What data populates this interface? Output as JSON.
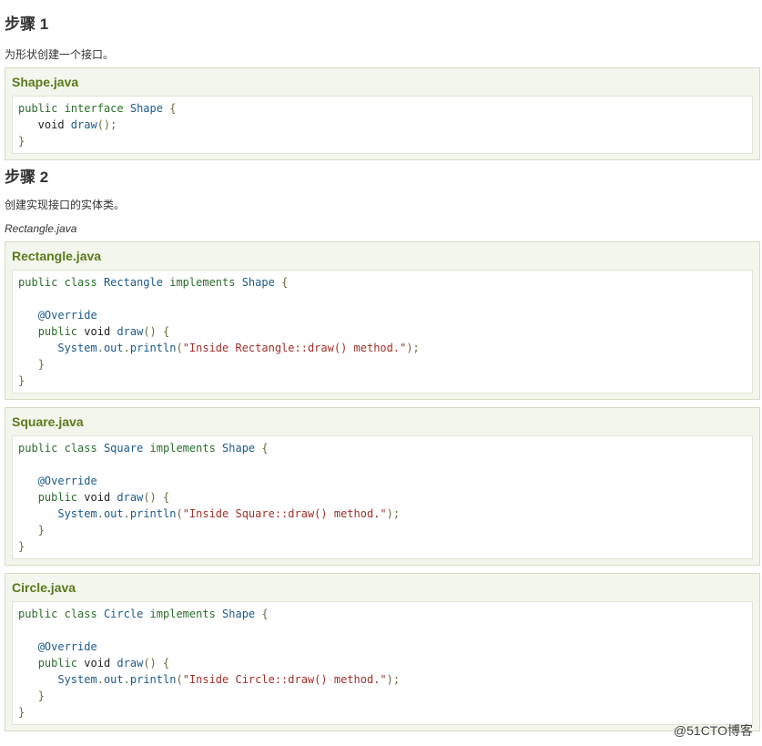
{
  "step1": {
    "heading": "步骤 1",
    "desc": "为形状创建一个接口。",
    "example": {
      "title": "Shape.java",
      "lines": [
        [
          [
            "kw",
            "public"
          ],
          [
            "pl",
            " "
          ],
          [
            "kw",
            "interface"
          ],
          [
            "pl",
            " "
          ],
          [
            "ty",
            "Shape"
          ],
          [
            "pl",
            " "
          ],
          [
            "pn",
            "{"
          ]
        ],
        [
          [
            "pl",
            "   void "
          ],
          [
            "ty",
            "draw"
          ],
          [
            "pn",
            "();"
          ]
        ],
        [
          [
            "pn",
            "}"
          ]
        ]
      ]
    }
  },
  "step2": {
    "heading": "步骤 2",
    "desc": "创建实现接口的实体类。",
    "file_label": "Rectangle.java",
    "examples": [
      {
        "title": "Rectangle.java",
        "lines": [
          [
            [
              "kw",
              "public"
            ],
            [
              "pl",
              " "
            ],
            [
              "kw",
              "class"
            ],
            [
              "pl",
              " "
            ],
            [
              "ty",
              "Rectangle"
            ],
            [
              "pl",
              " "
            ],
            [
              "kw",
              "implements"
            ],
            [
              "pl",
              " "
            ],
            [
              "ty",
              "Shape"
            ],
            [
              "pl",
              " "
            ],
            [
              "pn",
              "{"
            ]
          ],
          [
            [
              "pl",
              ""
            ]
          ],
          [
            [
              "pl",
              "   "
            ],
            [
              "ty",
              "@Override"
            ]
          ],
          [
            [
              "pl",
              "   "
            ],
            [
              "kw",
              "public"
            ],
            [
              "pl",
              " void "
            ],
            [
              "ty",
              "draw"
            ],
            [
              "pn",
              "()"
            ],
            [
              "pl",
              " "
            ],
            [
              "pn",
              "{"
            ]
          ],
          [
            [
              "pl",
              "      "
            ],
            [
              "ty",
              "System"
            ],
            [
              "pn",
              "."
            ],
            [
              "ty",
              "out"
            ],
            [
              "pn",
              "."
            ],
            [
              "ty",
              "println"
            ],
            [
              "pn",
              "("
            ],
            [
              "st",
              "\"Inside Rectangle::draw() method.\""
            ],
            [
              "pn",
              ");"
            ]
          ],
          [
            [
              "pl",
              "   "
            ],
            [
              "pn",
              "}"
            ]
          ],
          [
            [
              "pn",
              "}"
            ]
          ]
        ]
      },
      {
        "title": "Square.java",
        "lines": [
          [
            [
              "kw",
              "public"
            ],
            [
              "pl",
              " "
            ],
            [
              "kw",
              "class"
            ],
            [
              "pl",
              " "
            ],
            [
              "ty",
              "Square"
            ],
            [
              "pl",
              " "
            ],
            [
              "kw",
              "implements"
            ],
            [
              "pl",
              " "
            ],
            [
              "ty",
              "Shape"
            ],
            [
              "pl",
              " "
            ],
            [
              "pn",
              "{"
            ]
          ],
          [
            [
              "pl",
              ""
            ]
          ],
          [
            [
              "pl",
              "   "
            ],
            [
              "ty",
              "@Override"
            ]
          ],
          [
            [
              "pl",
              "   "
            ],
            [
              "kw",
              "public"
            ],
            [
              "pl",
              " void "
            ],
            [
              "ty",
              "draw"
            ],
            [
              "pn",
              "()"
            ],
            [
              "pl",
              " "
            ],
            [
              "pn",
              "{"
            ]
          ],
          [
            [
              "pl",
              "      "
            ],
            [
              "ty",
              "System"
            ],
            [
              "pn",
              "."
            ],
            [
              "ty",
              "out"
            ],
            [
              "pn",
              "."
            ],
            [
              "ty",
              "println"
            ],
            [
              "pn",
              "("
            ],
            [
              "st",
              "\"Inside Square::draw() method.\""
            ],
            [
              "pn",
              ");"
            ]
          ],
          [
            [
              "pl",
              "   "
            ],
            [
              "pn",
              "}"
            ]
          ],
          [
            [
              "pn",
              "}"
            ]
          ]
        ]
      },
      {
        "title": "Circle.java",
        "lines": [
          [
            [
              "kw",
              "public"
            ],
            [
              "pl",
              " "
            ],
            [
              "kw",
              "class"
            ],
            [
              "pl",
              " "
            ],
            [
              "ty",
              "Circle"
            ],
            [
              "pl",
              " "
            ],
            [
              "kw",
              "implements"
            ],
            [
              "pl",
              " "
            ],
            [
              "ty",
              "Shape"
            ],
            [
              "pl",
              " "
            ],
            [
              "pn",
              "{"
            ]
          ],
          [
            [
              "pl",
              ""
            ]
          ],
          [
            [
              "pl",
              "   "
            ],
            [
              "ty",
              "@Override"
            ]
          ],
          [
            [
              "pl",
              "   "
            ],
            [
              "kw",
              "public"
            ],
            [
              "pl",
              " void "
            ],
            [
              "ty",
              "draw"
            ],
            [
              "pn",
              "()"
            ],
            [
              "pl",
              " "
            ],
            [
              "pn",
              "{"
            ]
          ],
          [
            [
              "pl",
              "      "
            ],
            [
              "ty",
              "System"
            ],
            [
              "pn",
              "."
            ],
            [
              "ty",
              "out"
            ],
            [
              "pn",
              "."
            ],
            [
              "ty",
              "println"
            ],
            [
              "pn",
              "("
            ],
            [
              "st",
              "\"Inside Circle::draw() method.\""
            ],
            [
              "pn",
              ");"
            ]
          ],
          [
            [
              "pl",
              "   "
            ],
            [
              "pn",
              "}"
            ]
          ],
          [
            [
              "pn",
              "}"
            ]
          ]
        ]
      }
    ]
  },
  "watermark": "@51CTO博客",
  "colors": {
    "keyword": "#2a6d2a",
    "type": "#1b5a8a",
    "string": "#a0302a",
    "title": "#5a7a1c",
    "example_bg": "#f3f6ec"
  }
}
